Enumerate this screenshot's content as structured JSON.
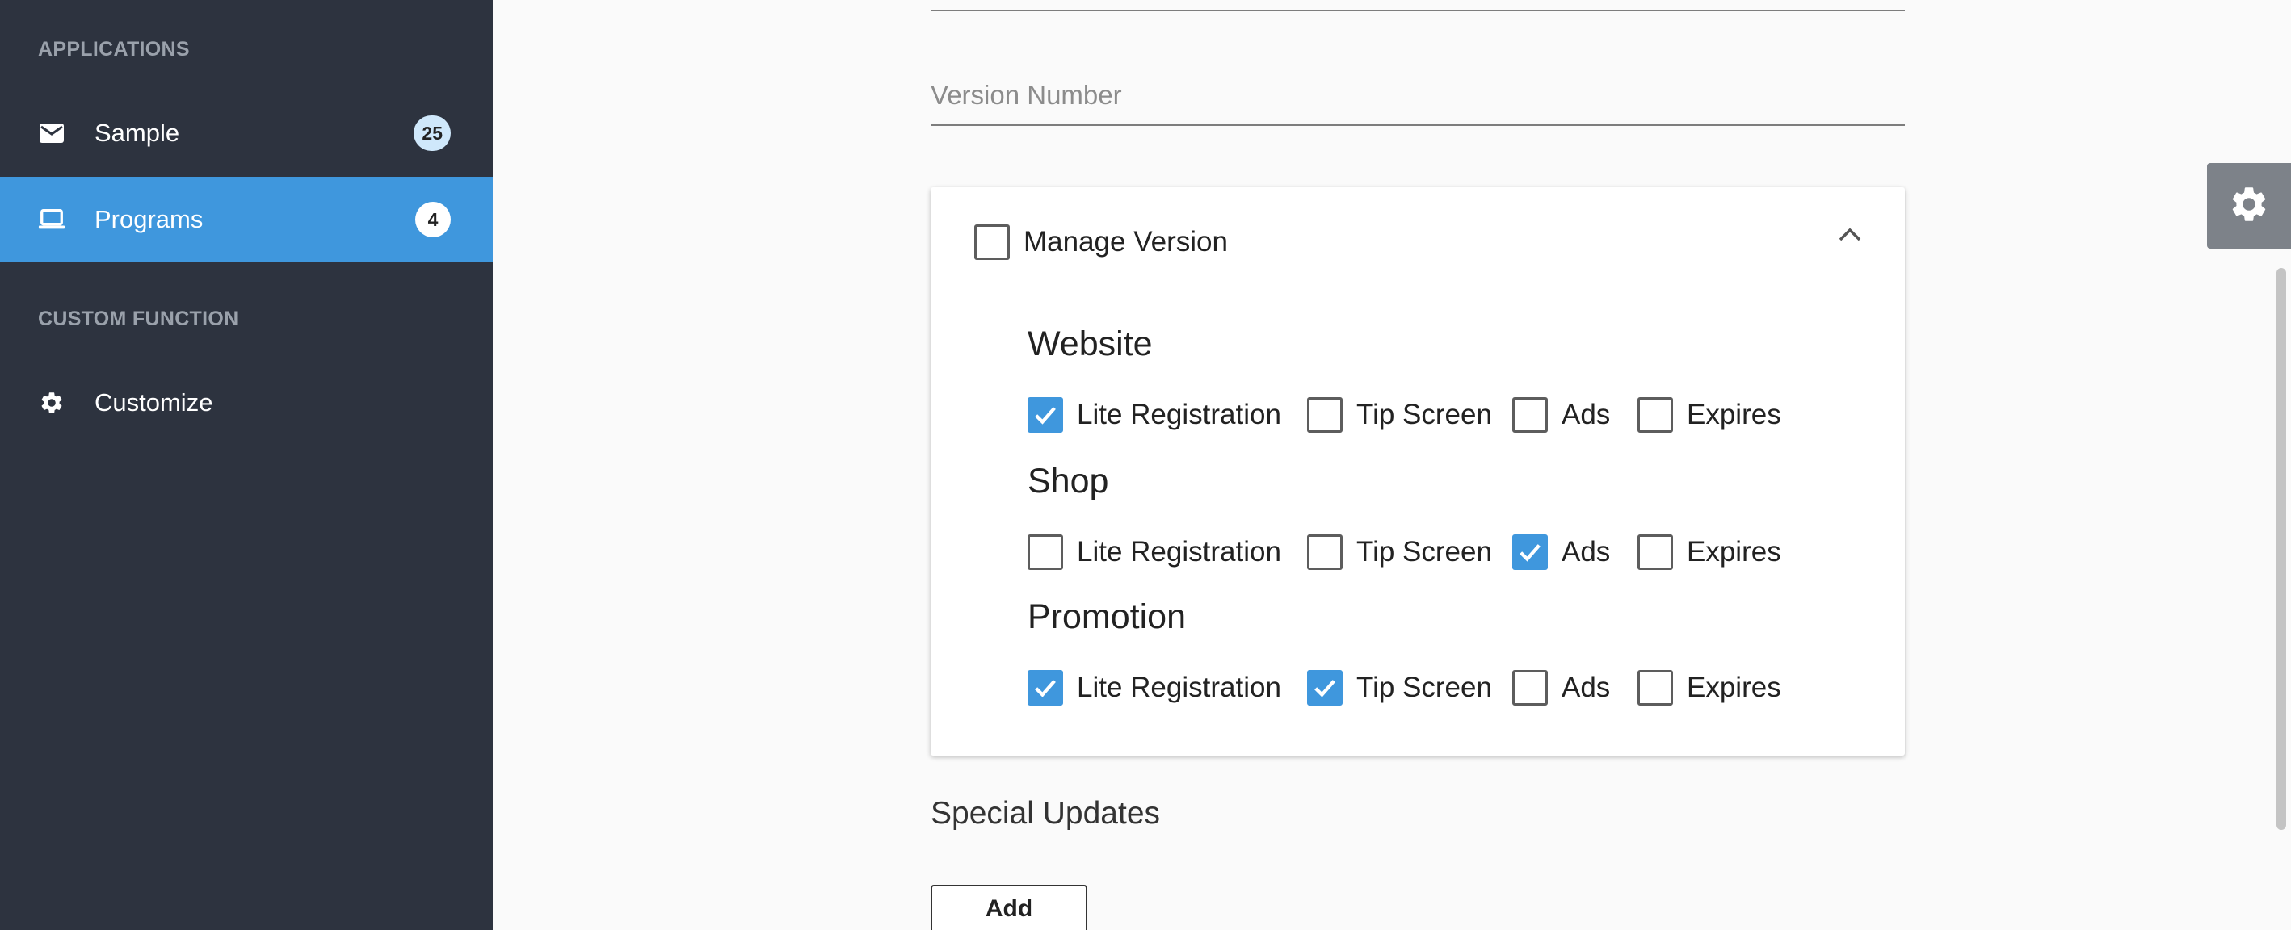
{
  "sidebar": {
    "sections": [
      {
        "label": "APPLICATIONS"
      },
      {
        "label": "CUSTOM FUNCTION"
      }
    ],
    "items": [
      {
        "label": "Sample",
        "icon": "mail-icon",
        "badge": "25"
      },
      {
        "label": "Programs",
        "icon": "laptop-icon",
        "badge": "4",
        "active": true
      },
      {
        "label": "Customize",
        "icon": "gear-icon"
      }
    ]
  },
  "form": {
    "version_placeholder": "Version Number",
    "version_value": ""
  },
  "manage_version": {
    "label": "Manage Version",
    "checked": false,
    "expanded": true,
    "option_labels": [
      "Lite Registration",
      "Tip Screen",
      "Ads",
      "Expires"
    ],
    "groups": [
      {
        "title": "Website",
        "checked": [
          true,
          false,
          false,
          false
        ]
      },
      {
        "title": "Shop",
        "checked": [
          false,
          false,
          true,
          false
        ]
      },
      {
        "title": "Promotion",
        "checked": [
          true,
          true,
          false,
          false
        ]
      }
    ]
  },
  "special_updates": {
    "title": "Special Updates",
    "add_label": "Add"
  },
  "colors": {
    "sidebar_bg": "#2d333f",
    "accent": "#3f97dd",
    "page_bg": "#fafafa"
  }
}
